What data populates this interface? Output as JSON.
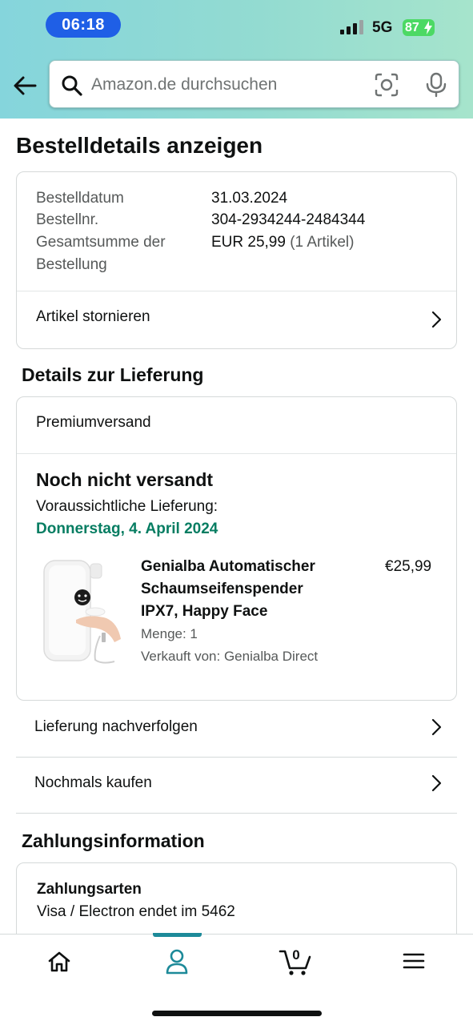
{
  "status_bar": {
    "time": "06:18",
    "network": "5G",
    "battery": "87"
  },
  "search": {
    "placeholder": "Amazon.de durchsuchen"
  },
  "page": {
    "title": "Bestelldetails anzeigen"
  },
  "order_summary": {
    "rows": [
      {
        "label": "Bestelldatum",
        "value": "31.03.2024"
      },
      {
        "label": "Bestellnr.",
        "value": "304-2934244-2484344"
      },
      {
        "label": "Gesamtsumme der Bestellung",
        "label_line1": "Gesamtsumme der",
        "label_line2": "Bestellung",
        "value": "EUR 25,99",
        "value_suffix": "(1 Artikel)"
      }
    ],
    "cancel_label": "Artikel stornieren"
  },
  "delivery": {
    "section_title": "Details zur Lieferung",
    "shipping_method": "Premiumversand",
    "status": "Noch nicht versandt",
    "eta_label": "Voraussichtliche Lieferung:",
    "eta_date": "Donnerstag, 4. April 2024",
    "item": {
      "title_line1": "Genialba Automatischer",
      "title_line2": "Schaumseifenspender",
      "title_line3": "IPX7, Happy Face",
      "price": "€25,99",
      "quantity": "Menge: 1",
      "seller": "Verkauft von: Genialba Direct"
    },
    "track_label": "Lieferung nachverfolgen",
    "buy_again_label": "Nochmals kaufen"
  },
  "payment": {
    "section_title": "Zahlungsinformation",
    "heading": "Zahlungsarten",
    "method": "Visa / Electron",
    "ending": "endet im 5462"
  },
  "bottom_nav": {
    "cart_count": "0",
    "items": [
      "home-icon",
      "account-icon",
      "cart-icon",
      "menu-icon"
    ],
    "active": "account-icon"
  },
  "colors": {
    "accent_teal": "#1d8a99",
    "delivery_green": "#067d62",
    "time_pill_blue": "#1f5fe6"
  }
}
